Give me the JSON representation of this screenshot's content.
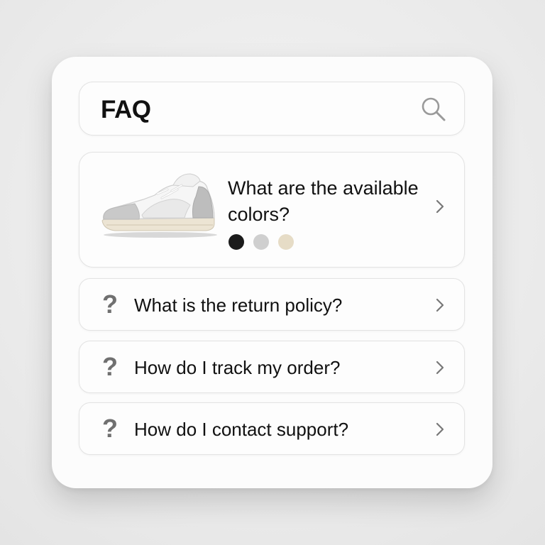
{
  "header": {
    "title": "FAQ",
    "search_icon": "search-icon"
  },
  "featured": {
    "question": "What are the available colors?",
    "image": "sneaker-image",
    "swatches": [
      {
        "name": "black",
        "color": "#1b1b1b"
      },
      {
        "name": "gray",
        "color": "#cfcfcf"
      },
      {
        "name": "cream",
        "color": "#e6dcc6"
      }
    ]
  },
  "faq_items": [
    {
      "icon": "question-icon",
      "question": "What is the return policy?"
    },
    {
      "icon": "question-icon",
      "question": "How do I track my order?"
    },
    {
      "icon": "question-icon",
      "question": "How do I contact support?"
    }
  ],
  "icons": {
    "question_glyph": "?",
    "chevron": "chevron-right-icon"
  }
}
